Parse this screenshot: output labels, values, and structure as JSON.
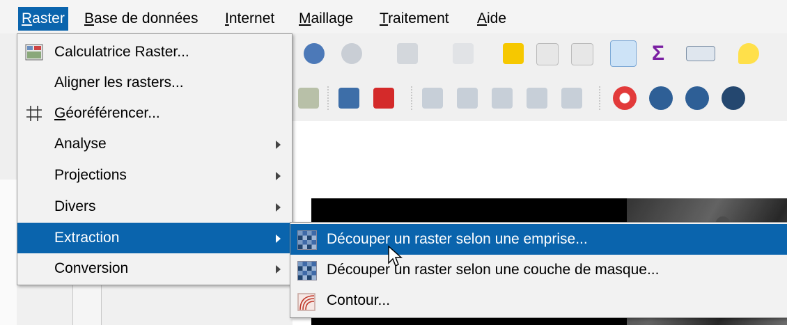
{
  "menubar": {
    "items": [
      {
        "label_mn": "R",
        "label_rest": "aster",
        "active": true
      },
      {
        "label_mn": "B",
        "label_rest": "ase de données"
      },
      {
        "label_mn": "I",
        "label_rest": "nternet"
      },
      {
        "label_mn": "M",
        "label_rest": "aillage"
      },
      {
        "label_mn": "T",
        "label_rest": "raitement"
      },
      {
        "label_mn": "A",
        "label_rest": "ide"
      }
    ]
  },
  "raster_menu": {
    "items": [
      {
        "label": "Calculatrice Raster...",
        "icon": "raster-calculator-icon"
      },
      {
        "label": "Aligner les rasters...",
        "icon": ""
      },
      {
        "label_mn": "G",
        "label_rest": "éoréférencer...",
        "icon": "georeferencer-grid-icon"
      },
      {
        "label": "Analyse",
        "submenu": true
      },
      {
        "label": "Projections",
        "submenu": true
      },
      {
        "label": "Divers",
        "submenu": true
      },
      {
        "label": "Extraction",
        "submenu": true,
        "highlighted": true
      },
      {
        "label": "Conversion",
        "submenu": true
      }
    ]
  },
  "extraction_submenu": {
    "items": [
      {
        "label": "Découper un raster selon une emprise...",
        "icon": "clip-raster-extent-icon",
        "highlighted": true
      },
      {
        "label": "Découper un raster selon une couche de masque...",
        "icon": "clip-raster-mask-icon"
      },
      {
        "label": "Contour...",
        "icon": "contour-icon"
      }
    ]
  },
  "colors": {
    "highlight": "#0a64ad",
    "menu_bg": "#f2f2f2"
  }
}
